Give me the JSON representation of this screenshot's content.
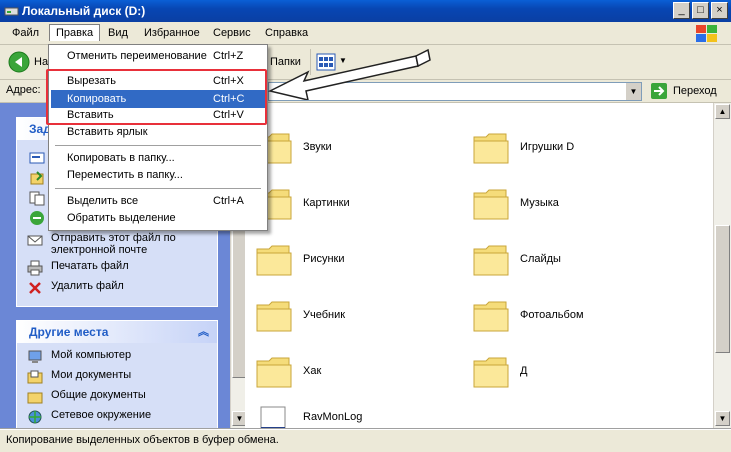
{
  "window": {
    "title": "Локальный диск (D:)",
    "controls": [
      "_",
      "□",
      "×"
    ]
  },
  "menubar": {
    "items": [
      "Файл",
      "Правка",
      "Вид",
      "Избранное",
      "Сервис",
      "Справка"
    ],
    "active": "Правка"
  },
  "toolbar": {
    "back_label": "На",
    "folders_label": "Папки"
  },
  "address": {
    "label": "Адрес:",
    "value": "",
    "go_label": "Переход"
  },
  "edit_menu": {
    "items": [
      {
        "label": "Отменить переименование",
        "shortcut": "Ctrl+Z"
      },
      {
        "label": "Вырезать",
        "shortcut": "Ctrl+X"
      },
      {
        "label": "Копировать",
        "shortcut": "Ctrl+C",
        "highlighted": true
      },
      {
        "label": "Вставить",
        "shortcut": "Ctrl+V"
      },
      {
        "label": "Вставить ярлык",
        "shortcut": ""
      },
      {
        "label": "Копировать в папку...",
        "shortcut": ""
      },
      {
        "label": "Переместить в папку...",
        "shortcut": ""
      },
      {
        "label": "Выделить все",
        "shortcut": "Ctrl+A"
      },
      {
        "label": "Обратить выделение",
        "shortcut": ""
      }
    ]
  },
  "tasks_panel": {
    "title": "Зад",
    "items": [
      "Отправить этот файл по электронной почте",
      "Печатать файл",
      "Удалить файл"
    ]
  },
  "other_places": {
    "title": "Другие места",
    "items": [
      "Мой компьютер",
      "Мои документы",
      "Общие документы",
      "Сетевое окружение"
    ]
  },
  "files": [
    {
      "name": "Звуки",
      "type": "folder"
    },
    {
      "name": "Игрушки D",
      "type": "folder"
    },
    {
      "name": "Картинки",
      "type": "folder"
    },
    {
      "name": "Музыка",
      "type": "folder"
    },
    {
      "name": "Рисунки",
      "type": "folder"
    },
    {
      "name": "Слайды",
      "type": "folder"
    },
    {
      "name": "Учебник",
      "type": "folder"
    },
    {
      "name": "Фотоальбом",
      "type": "folder"
    },
    {
      "name": "Хак",
      "type": "folder"
    },
    {
      "name": "Д",
      "type": "folder"
    },
    {
      "name": "RavMonLog",
      "type": "file"
    }
  ],
  "status": {
    "text": "Копирование выделенных объектов в буфер обмена."
  },
  "colors": {
    "highlight": "#316ac5",
    "annotation_red": "#e8303a",
    "titlebar": "#0846b3"
  }
}
